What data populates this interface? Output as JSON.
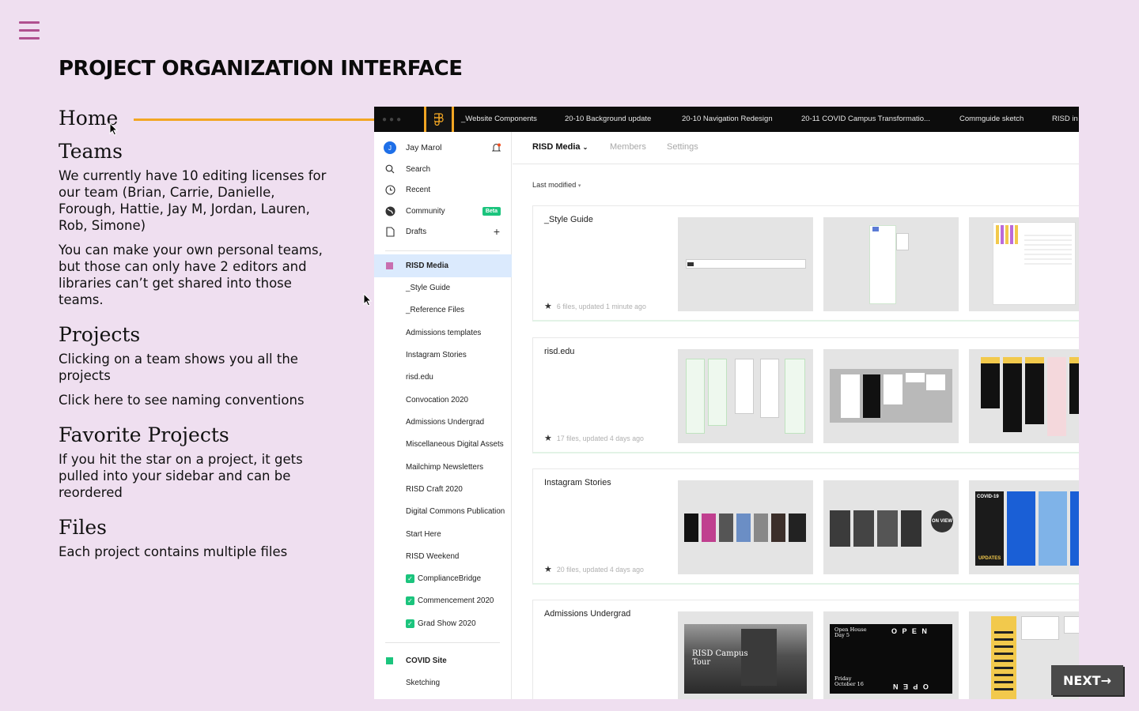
{
  "slide": {
    "title": "PROJECT ORGANIZATION INTERFACE",
    "next_label": "NEXT→",
    "sections": {
      "home": {
        "heading": "Home"
      },
      "teams": {
        "heading": "Teams",
        "p1": "We currently have 10 editing licenses for our team (Brian, Carrie, Danielle, Forough, Hattie, Jay M, Jordan, Lauren, Rob, Simone)",
        "p2": "You can make your own personal teams, but those can only have 2 editors and libraries can’t get shared into those teams."
      },
      "projects": {
        "heading": "Projects",
        "p1": "Clicking on a team shows you all the projects",
        "p2": "Click here to see naming conventions"
      },
      "favorites": {
        "heading": "Favorite Projects",
        "p1": "If you hit the star on a project, it gets pulled into your sidebar and can be reordered"
      },
      "files": {
        "heading": "Files",
        "p1": "Each project contains multiple files"
      }
    }
  },
  "app": {
    "tabs": [
      "_Website Components",
      "20-10 Background update",
      "20-10 Navigation Redesign",
      "20-11 COVID Campus Transformatio...",
      "Commguide sketch",
      "RISD in"
    ],
    "sidebar": {
      "user": {
        "initial": "J",
        "name": "Jay Marol"
      },
      "nav": [
        {
          "label": "Search",
          "icon": "search-icon"
        },
        {
          "label": "Recent",
          "icon": "clock-icon"
        },
        {
          "label": "Community",
          "icon": "globe-icon",
          "badge": "Beta"
        },
        {
          "label": "Drafts",
          "icon": "file-icon"
        }
      ],
      "team": "RISD Media",
      "projects": [
        "_Style Guide",
        "_Reference Files",
        "Admissions templates",
        "Instagram Stories",
        "risd.edu",
        "Convocation 2020",
        "Admissions Undergrad",
        "Miscellaneous Digital Assets",
        "Mailchimp Newsletters",
        "RISD Craft 2020",
        "Digital Commons Publication",
        "Start Here",
        "RISD Weekend"
      ],
      "checked": [
        "ComplianceBridge",
        "Commencement 2020",
        "Grad Show 2020"
      ],
      "team2": "COVID Site",
      "team2_items": [
        "Sketching"
      ]
    },
    "main": {
      "team_title": "RISD Media",
      "links": [
        "Members",
        "Settings"
      ],
      "sort_label": "Last modified",
      "projects": [
        {
          "name": "_Style Guide",
          "meta": "6 files, updated 1 minute ago"
        },
        {
          "name": "risd.edu",
          "meta": "17 files, updated 4 days ago"
        },
        {
          "name": "Instagram Stories",
          "meta": "20 files, updated 4 days ago"
        },
        {
          "name": "Admissions Undergrad",
          "meta": ""
        }
      ],
      "thumb_text": {
        "campus_tour": "RISD Campus Tour",
        "open_house": "Open House Day 5",
        "open_house_date": "Friday October 16",
        "open_word": "O P E N",
        "covid_label": "COVID-19",
        "updates_label": "UPDATES",
        "on_view": "ON VIEW"
      }
    },
    "colors": {
      "accent": "#f2a623",
      "selected": "#dbeafd",
      "green": "#1bc47d",
      "blue": "#1e6fe8",
      "team_square": "#c86fb0"
    }
  }
}
